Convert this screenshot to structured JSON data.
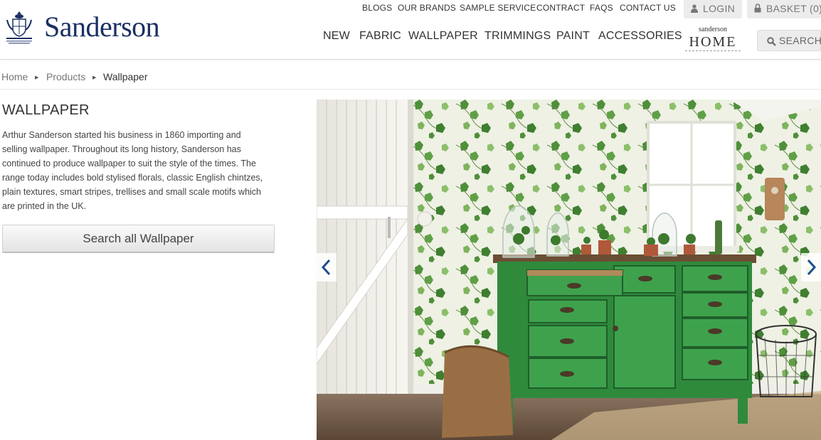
{
  "brand": {
    "name": "Sanderson",
    "crest": "royal-warrant-crest"
  },
  "utility_nav": [
    "BLOGS",
    "OUR BRANDS",
    "SAMPLE SERVICE",
    "CONTRACT",
    "FAQS",
    "CONTACT US"
  ],
  "account": {
    "login": "LOGIN",
    "basket": "BASKET (0)"
  },
  "main_nav": [
    "NEW",
    "FABRIC",
    "WALLPAPER",
    "TRIMMINGS",
    "PAINT",
    "ACCESSORIES"
  ],
  "home_brand": {
    "small": "sanderson",
    "big": "HOME"
  },
  "search": {
    "label": "SEARCH"
  },
  "breadcrumb": [
    "Home",
    "Products",
    "Wallpaper"
  ],
  "page": {
    "title": "WALLPAPER",
    "description_lines": [
      "Arthur Sanderson started his business in 1860 importing and",
      "selling wallpaper. Throughout its long history, Sanderson has",
      "continued to produce wallpaper to suit the style of the times. The",
      "range today includes bold stylised florals, classic English chintzes,",
      "plain textures, smart stripes, trellises and small scale motifs which",
      "are printed in the UK."
    ],
    "search_button": "Search all Wallpaper"
  },
  "colors": {
    "brand_navy": "#1b2f63",
    "nav_grey": "#ececec",
    "carousel_arrow": "#1f4e8c"
  },
  "icons": {
    "login": "user-icon",
    "basket": "lock-icon",
    "search": "magnifier-icon",
    "prev": "chevron-left-icon",
    "next": "chevron-right-icon"
  }
}
